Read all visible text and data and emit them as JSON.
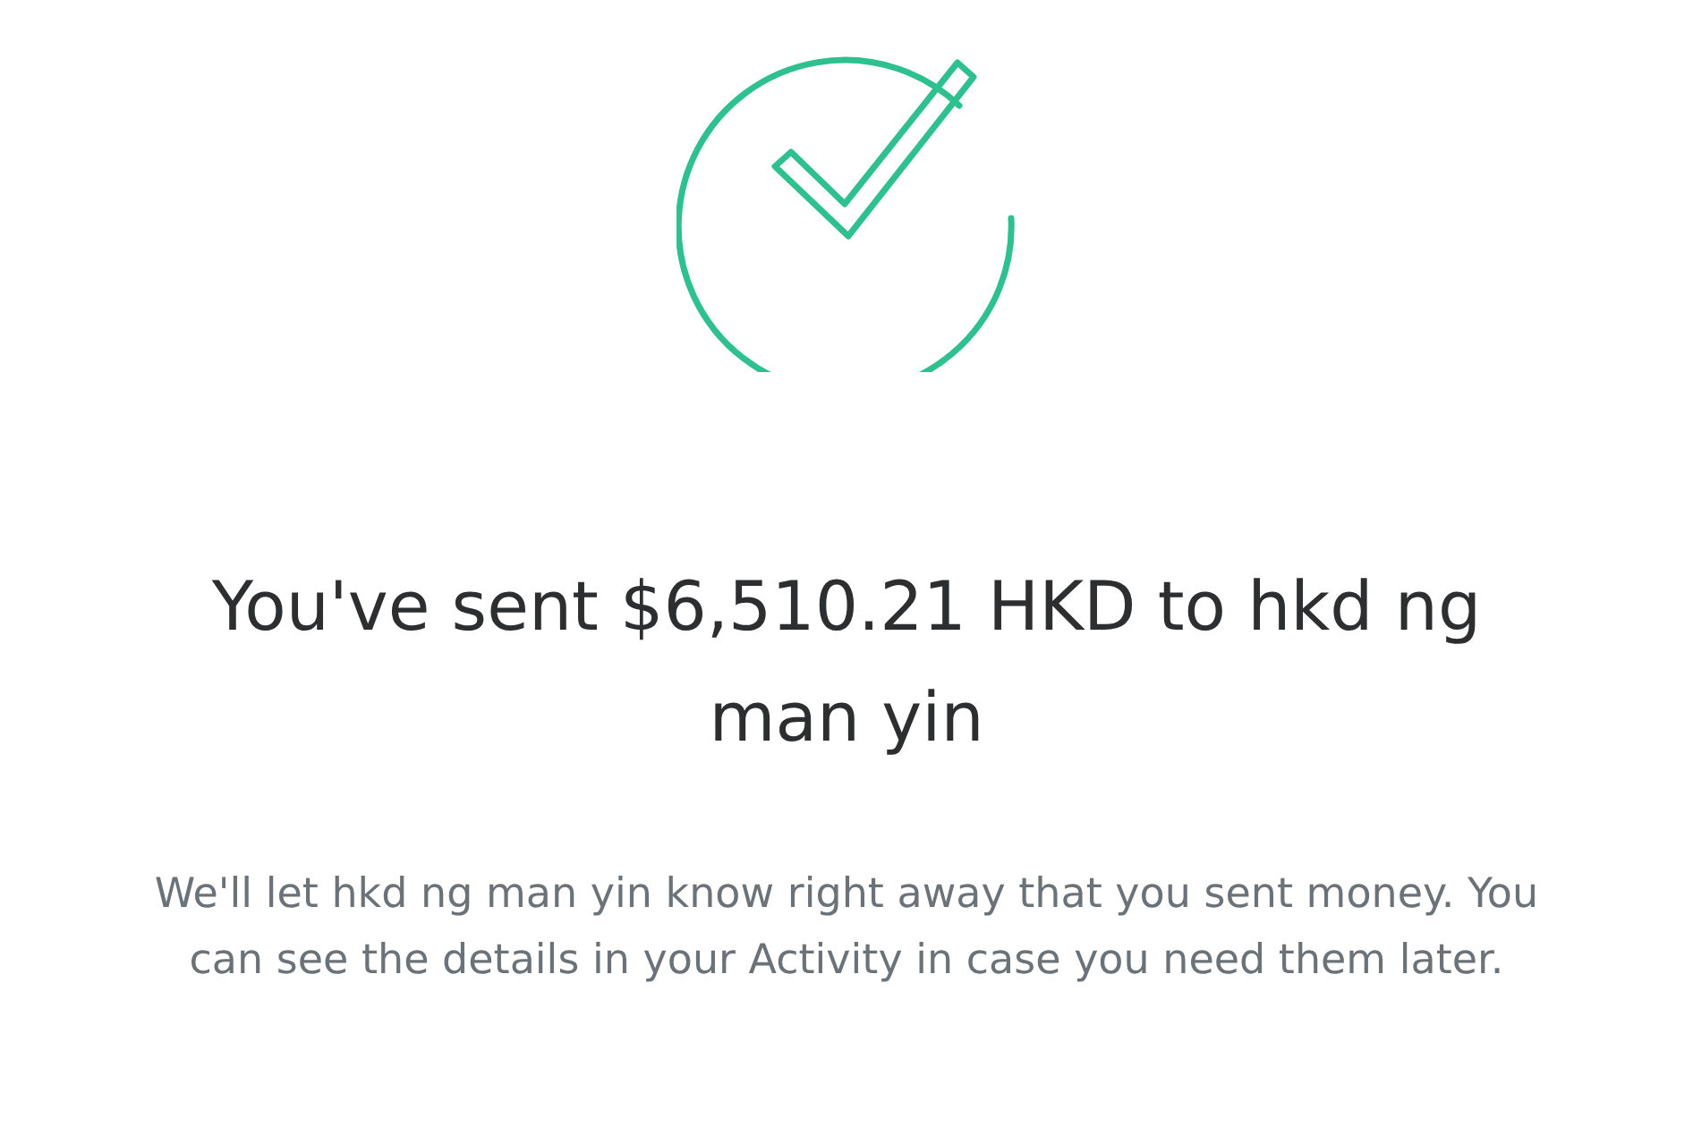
{
  "confirmation": {
    "title": "You've sent $6,510.21 HKD to hkd ng man yin",
    "message": "We'll let hkd ng man yin know right away that you sent money. You can see the details in your Activity in case you need them later."
  }
}
